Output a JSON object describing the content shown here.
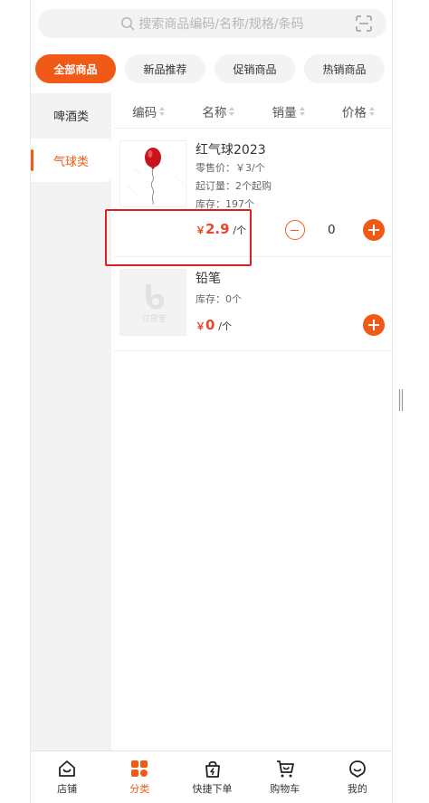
{
  "search": {
    "placeholder": "搜索商品编码/名称/规格/条码"
  },
  "chips": [
    {
      "label": "全部商品",
      "active": true
    },
    {
      "label": "新品推荐",
      "active": false
    },
    {
      "label": "促销商品",
      "active": false
    },
    {
      "label": "热销商品",
      "active": false
    }
  ],
  "categories": [
    {
      "label": "啤酒类",
      "active": false
    },
    {
      "label": "气球类",
      "active": true
    }
  ],
  "sort_header": {
    "code": "编码",
    "name": "名称",
    "sales": "销量",
    "price": "价格"
  },
  "products": [
    {
      "name": "红气球2023",
      "retail": "零售价：￥3/个",
      "min_order": "起订量：2个起购",
      "stock": "库存：197个",
      "currency": "￥",
      "price": "2.9",
      "unit": "/个",
      "quantity": "0"
    },
    {
      "name": "铅笔",
      "stock": "库存：0个",
      "currency": "￥",
      "price": "0",
      "unit": "/个",
      "placeholder_logo_text": "订货宝"
    }
  ],
  "tabs": [
    {
      "label": "店铺",
      "icon": "store-icon",
      "active": false
    },
    {
      "label": "分类",
      "icon": "category-icon",
      "active": true
    },
    {
      "label": "快捷下单",
      "icon": "quick-order-icon",
      "active": false
    },
    {
      "label": "购物车",
      "icon": "cart-icon",
      "active": false
    },
    {
      "label": "我的",
      "icon": "profile-icon",
      "active": false
    }
  ],
  "colors": {
    "accent": "#f05a16",
    "price": "#e8472c",
    "highlight": "#e02020"
  }
}
